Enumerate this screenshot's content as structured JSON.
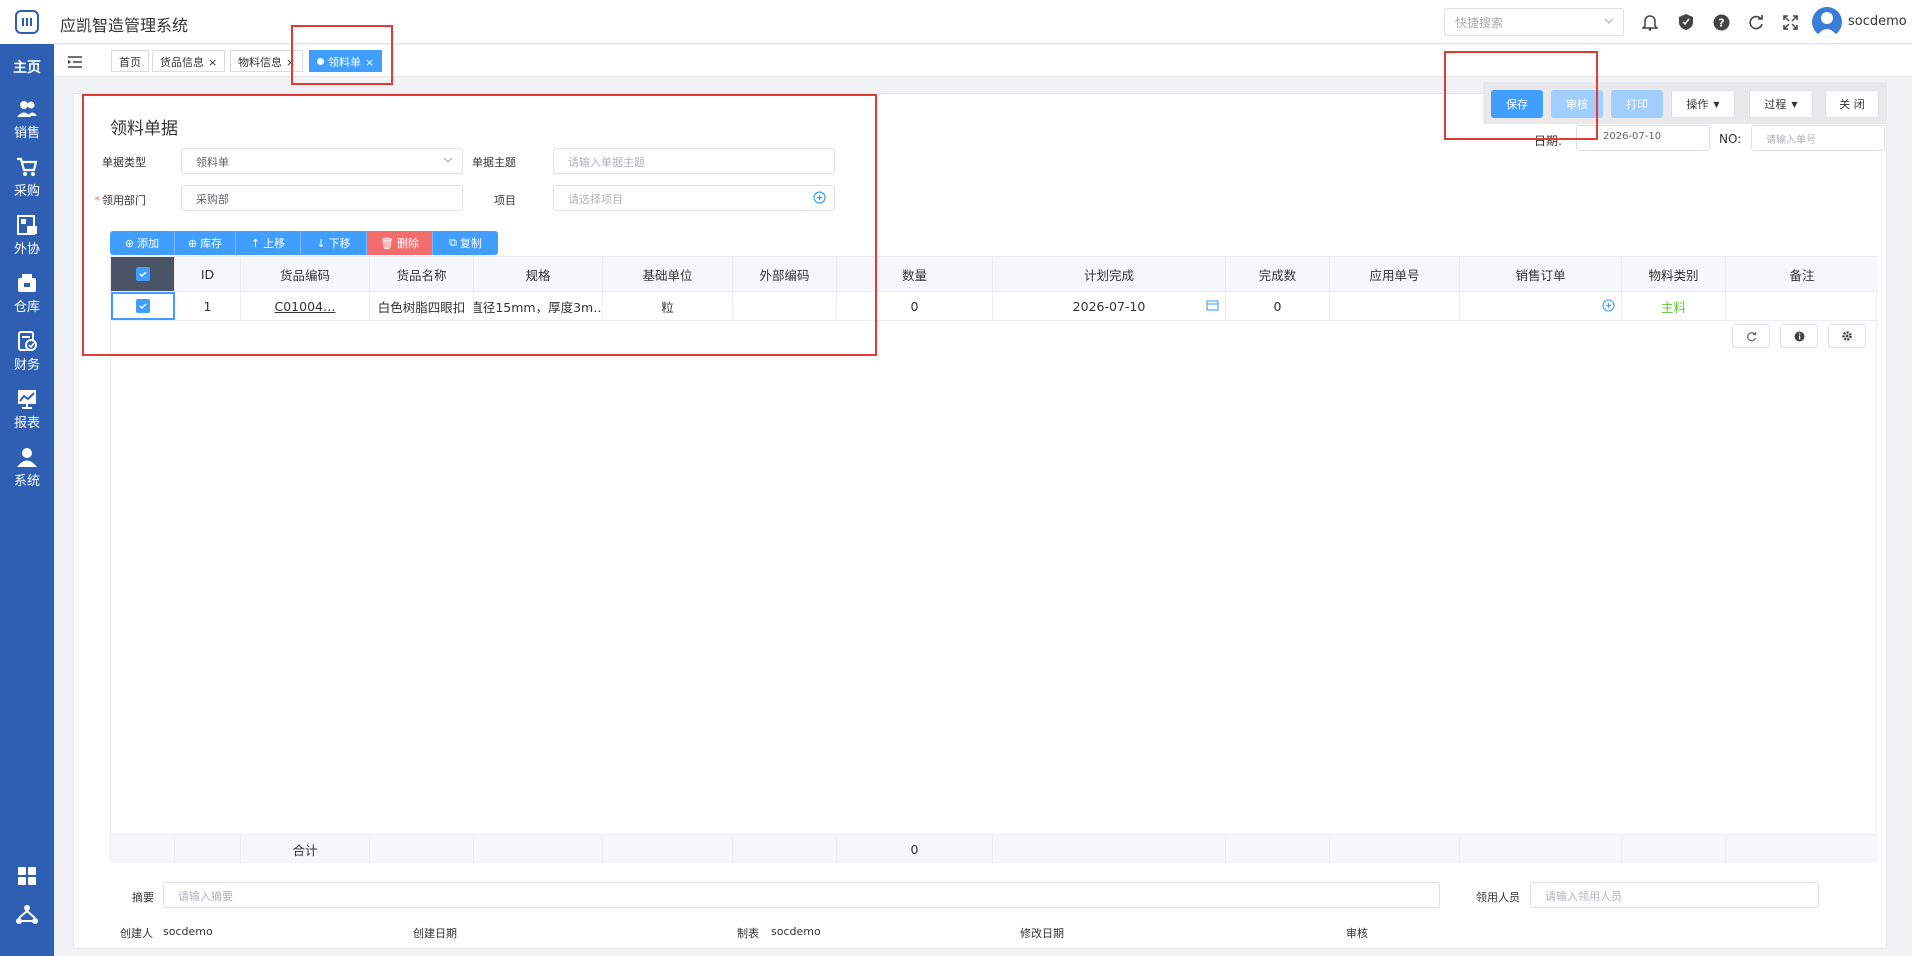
{
  "app": {
    "title": "应凯智造管理系统"
  },
  "sidebar": {
    "home": "主页",
    "items": [
      {
        "label": "销售",
        "icon": "users-icon"
      },
      {
        "label": "采购",
        "icon": "cart-icon"
      },
      {
        "label": "外协",
        "icon": "outsource-icon"
      },
      {
        "label": "仓库",
        "icon": "warehouse-icon"
      },
      {
        "label": "财务",
        "icon": "finance-icon"
      },
      {
        "label": "报表",
        "icon": "report-icon"
      },
      {
        "label": "系统",
        "icon": "user-icon"
      }
    ]
  },
  "header": {
    "search_placeholder": "快捷搜索",
    "username": "socdemo"
  },
  "tabs": [
    {
      "label": "首页"
    },
    {
      "label": "货品信息"
    },
    {
      "label": "物料信息"
    },
    {
      "label": "领料单"
    }
  ],
  "form": {
    "title": "领料单据",
    "doc_type_label": "单据类型",
    "doc_type_value": "领料单",
    "subject_label": "单据主题",
    "subject_placeholder": "请输入单据主题",
    "dept_label": "领用部门",
    "dept_value": "采购部",
    "project_label": "项目",
    "project_placeholder": "请选择项目",
    "date_label": "日期:",
    "date_value": "2026-07-10",
    "no_label": "NO:",
    "no_placeholder": "请输入单号"
  },
  "actions": {
    "save": "保存",
    "audit": "审核",
    "print": "打印",
    "operate": "操作",
    "process": "过程",
    "close": "关 闭"
  },
  "grid_buttons": {
    "add": "添加",
    "stock": "库存",
    "up": "上移",
    "down": "下移",
    "delete": "删除",
    "copy": "复制"
  },
  "table": {
    "headers": [
      "ID",
      "货品编码",
      "货品名称",
      "规格",
      "基础单位",
      "外部编码",
      "数量",
      "计划完成",
      "完成数",
      "应用单号",
      "销售订单",
      "物料类别",
      "备注"
    ],
    "rows": [
      {
        "id": "1",
        "code": "C01004…",
        "name": "白色树脂四眼扣",
        "spec": "直径15mm，厚度3m…",
        "unit": "粒",
        "ext_code": "",
        "qty": "0",
        "plan_date": "2026-07-10",
        "done": "0",
        "app_no": "",
        "sales_order": "",
        "category": "主料",
        "remark": ""
      }
    ],
    "footer_label": "合计",
    "footer_qty": "0"
  },
  "bottom": {
    "summary_label": "摘要",
    "summary_placeholder": "请输入摘要",
    "picker_label": "领用人员",
    "picker_placeholder": "请输入领用人员",
    "creator_label": "创建人",
    "creator_value": "socdemo",
    "create_date_label": "创建日期",
    "maker_label": "制表",
    "maker_value": "socdemo",
    "modify_date_label": "修改日期",
    "auditor_label": "审核"
  },
  "colors": {
    "sidebar": "#2f5fb3",
    "primary": "#409eff",
    "danger": "#f56c6c",
    "highlight": "#e53935"
  }
}
